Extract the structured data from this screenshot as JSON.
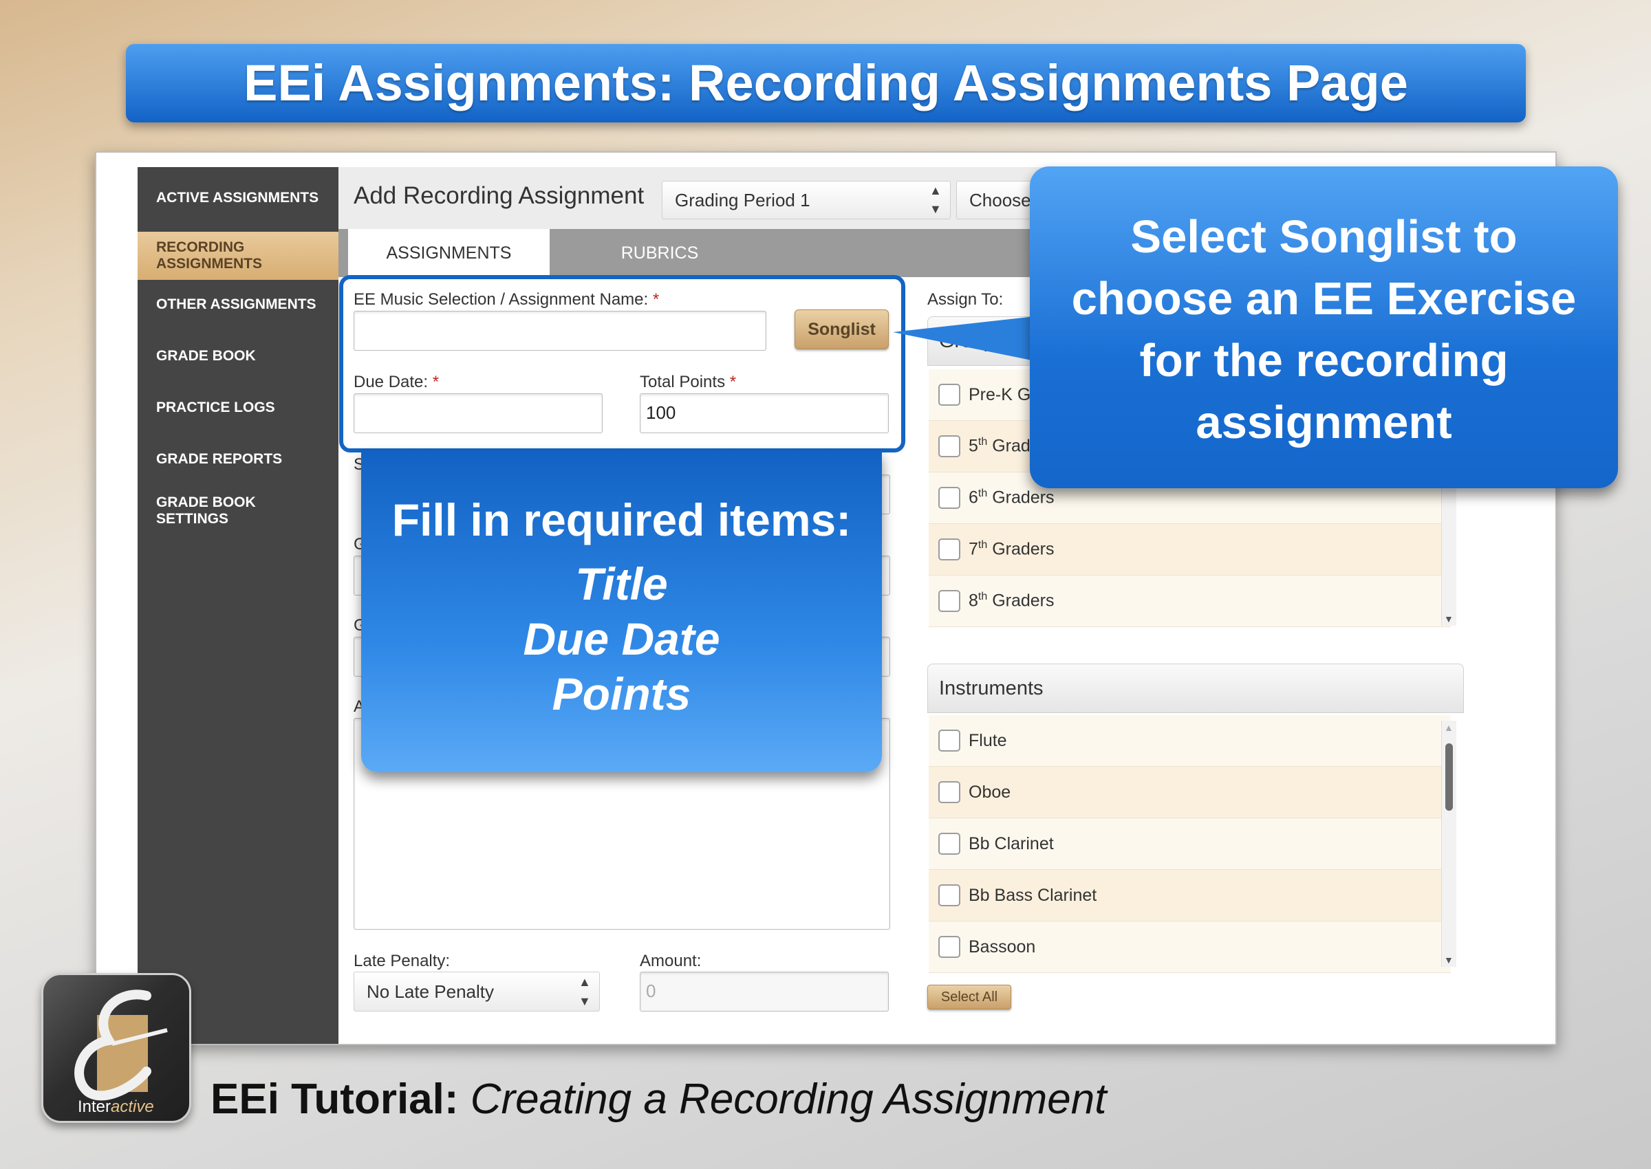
{
  "slide_title": "EEi Assignments: Recording Assignments Page",
  "sidebar": {
    "items": [
      {
        "label": "ACTIVE ASSIGNMENTS"
      },
      {
        "label": "RECORDING ASSIGNMENTS",
        "line1": "RECORDING",
        "line2": "ASSIGNMENTS",
        "active": true
      },
      {
        "label": "OTHER ASSIGNMENTS"
      },
      {
        "label": "GRADE BOOK"
      },
      {
        "label": "PRACTICE LOGS"
      },
      {
        "label": "GRADE REPORTS"
      },
      {
        "label": "GRADE BOOK SETTINGS",
        "line1": "GRADE BOOK",
        "line2": "SETTINGS"
      }
    ]
  },
  "header": {
    "title": "Add Recording Assignment",
    "grading_period": "Grading Period 1",
    "choose_select": "Choose"
  },
  "tabs": [
    {
      "label": "ASSIGNMENTS",
      "active": true
    },
    {
      "label": "RUBRICS",
      "active": false
    }
  ],
  "form": {
    "name_label": "EE Music Selection / Assignment Name:",
    "required_mark": "*",
    "name_value": "",
    "songlist_button": "Songlist",
    "due_date_label": "Due Date:",
    "due_date_value": "",
    "total_points_label": "Total Points",
    "total_points_value": "100",
    "hidden_label_1": "S",
    "hidden_label_2": "G",
    "hidden_label_3": "G",
    "hidden_label_4": "A",
    "late_penalty_label": "Late Penalty:",
    "late_penalty_value": "No Late Penalty",
    "amount_label": "Amount:",
    "amount_placeholder": "0"
  },
  "assign_to": {
    "label": "Assign To:",
    "groups_header": "Groups",
    "groups": [
      {
        "label": "Pre-K G"
      },
      {
        "num": "5",
        "sup": "th",
        "rest": " Grad"
      },
      {
        "num": "6",
        "sup": "th",
        "rest": " Graders"
      },
      {
        "num": "7",
        "sup": "th",
        "rest": " Graders"
      },
      {
        "num": "8",
        "sup": "th",
        "rest": " Graders"
      }
    ],
    "instruments_header": "Instruments",
    "instruments": [
      {
        "label": "Flute"
      },
      {
        "label": "Oboe"
      },
      {
        "label": "Bb Clarinet"
      },
      {
        "label": "Bb Bass Clarinet"
      },
      {
        "label": "Bassoon"
      }
    ],
    "select_all_button": "Select All"
  },
  "callouts": {
    "songlist_line1": "Select Songlist to",
    "songlist_line2": "choose an EE Exercise",
    "songlist_line3": "for the recording",
    "songlist_line4": "assignment",
    "required_heading": "Fill in required items:",
    "required_item1": "Title",
    "required_item2": "Due Date",
    "required_item3": "Points"
  },
  "logo": {
    "text_plain": "Inter",
    "text_italic": "active"
  },
  "footer": {
    "bold": "EEi Tutorial:",
    "italic": "Creating a Recording Assignment"
  }
}
